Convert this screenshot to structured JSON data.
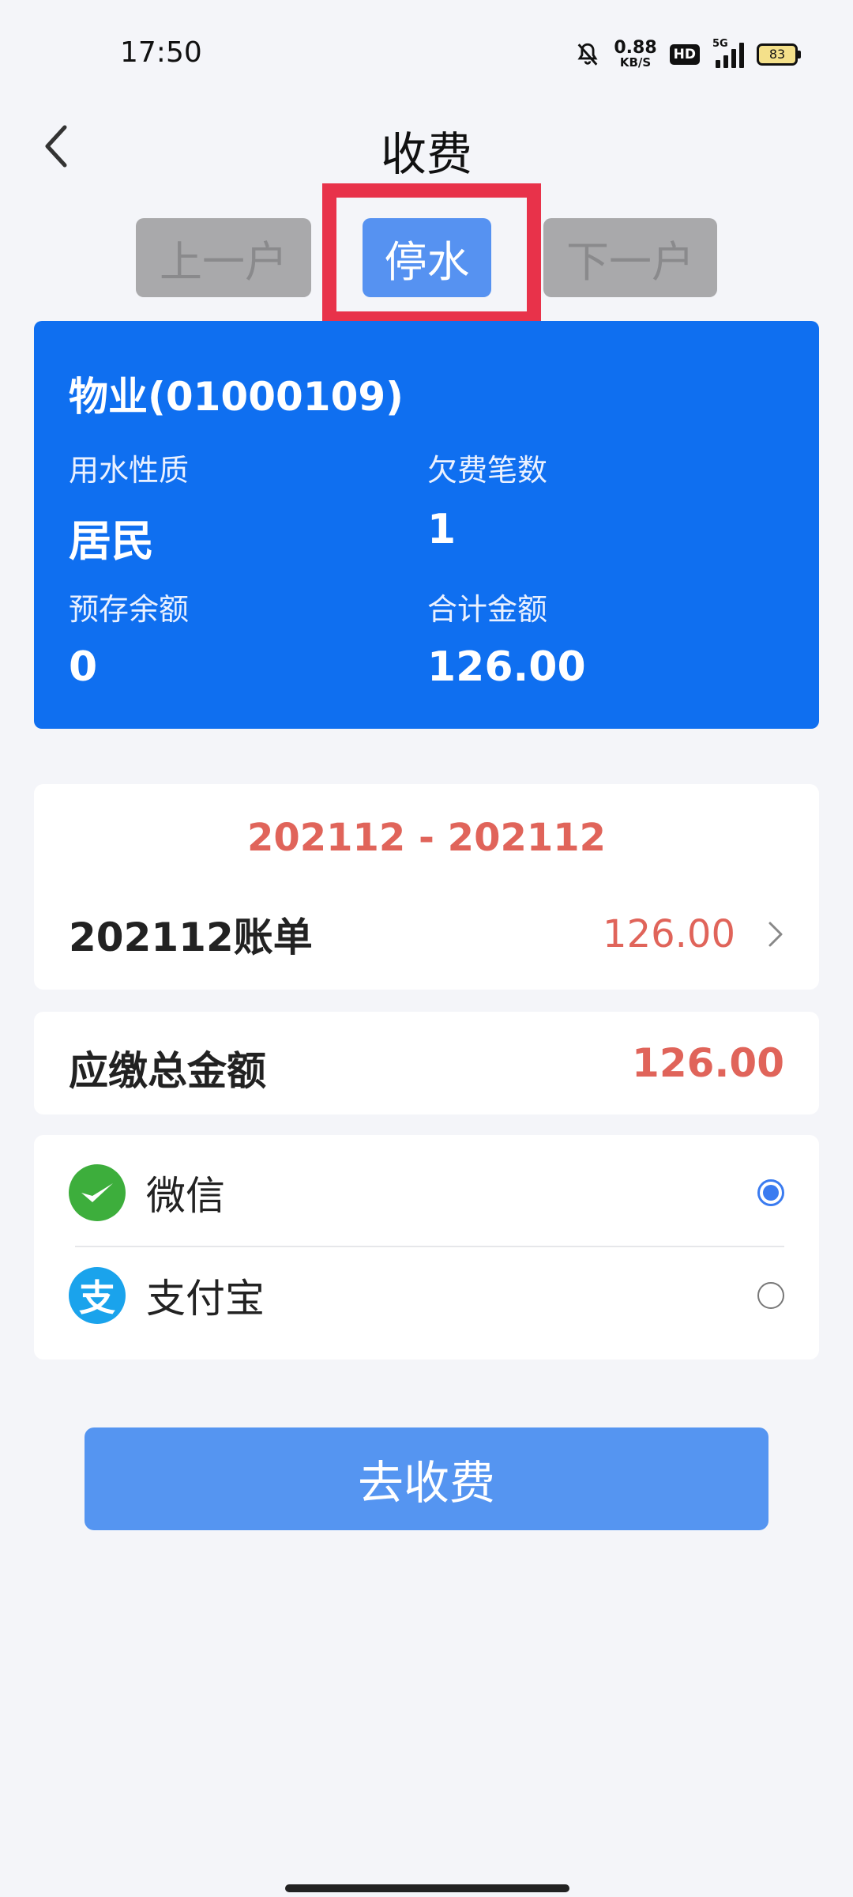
{
  "status_bar": {
    "time": "17:50",
    "net_speed_value": "0.88",
    "net_speed_unit": "KB/S",
    "hd_label": "HD",
    "network_label": "5G",
    "battery": "83"
  },
  "header": {
    "title": "收费"
  },
  "nav": {
    "prev_label": "上一户",
    "stop_water_label": "停水",
    "next_label": "下一户"
  },
  "info": {
    "title": "物业(01000109)",
    "water_type_label": "用水性质",
    "water_type_value": "居民",
    "arrears_count_label": "欠费笔数",
    "arrears_count_value": "1",
    "prepaid_label": "预存余额",
    "prepaid_value": "0",
    "total_label": "合计金额",
    "total_value": "126.00"
  },
  "bill": {
    "period": "202112 - 202112",
    "name": "202112账单",
    "amount": "126.00"
  },
  "total_due": {
    "label": "应缴总金额",
    "amount": "126.00"
  },
  "payment": {
    "options": [
      {
        "label": "微信",
        "icon": "wechat-icon",
        "selected": true
      },
      {
        "label": "支付宝",
        "icon": "alipay-icon",
        "icon_glyph": "支",
        "selected": false
      }
    ]
  },
  "charge_button": {
    "label": "去收费"
  },
  "colors": {
    "primary_blue": "#0f6ff0",
    "button_blue": "#5595f1",
    "amount_red": "#e0645a",
    "highlight_red": "#e8324a"
  }
}
